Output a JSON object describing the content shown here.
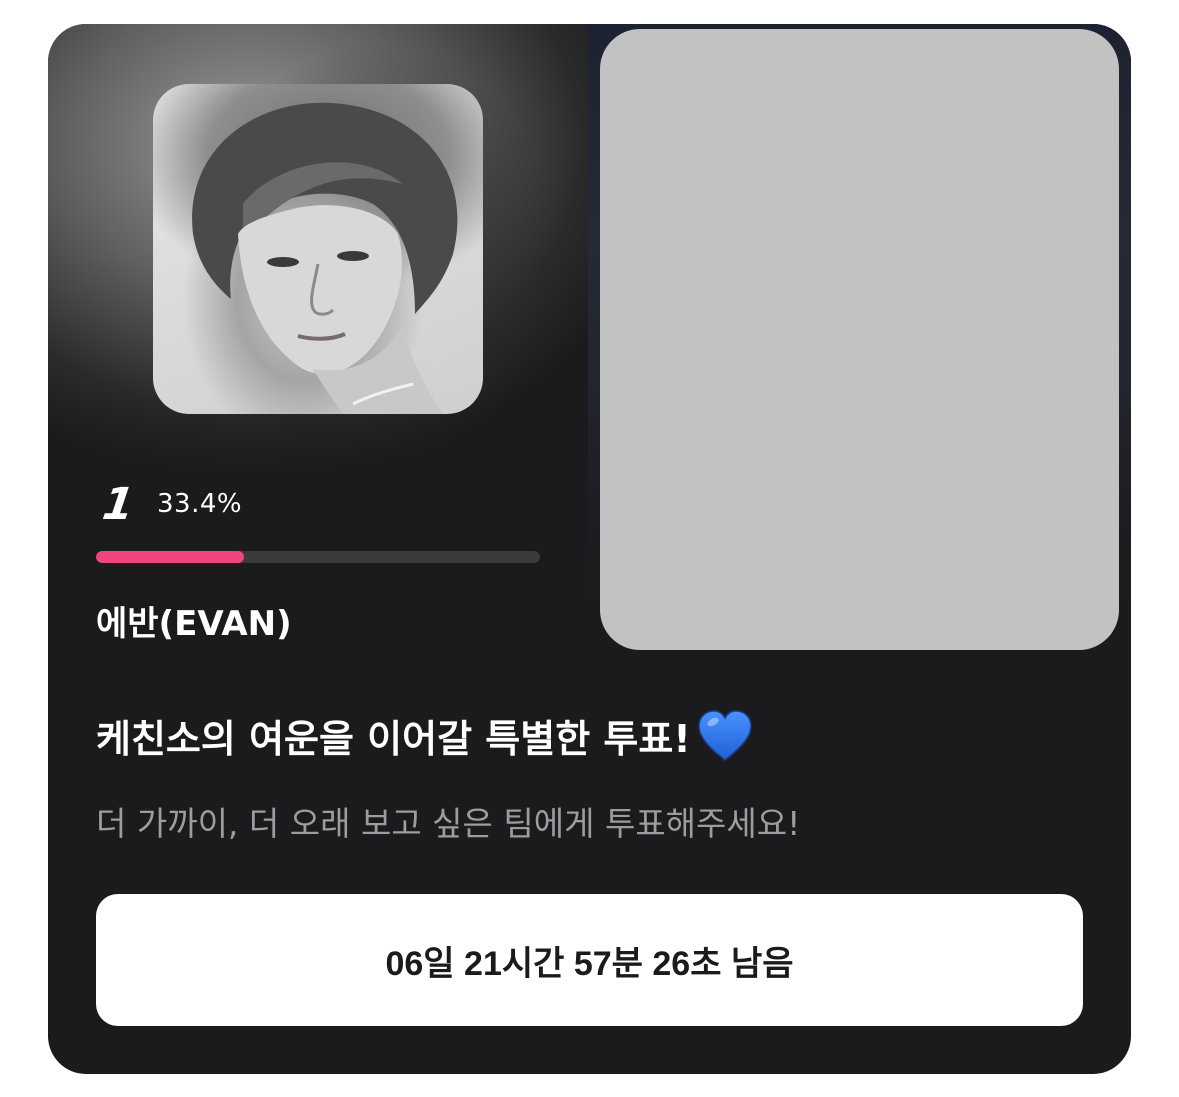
{
  "candidate": {
    "rank": "1",
    "percent_text": "33.4%",
    "vote_share": 0.334,
    "name": "에반(EVAN)",
    "bar_color": "#f0457e"
  },
  "vote": {
    "title": "케친소의 여운을 이어갈 특별한 투표!",
    "title_emoji": "blue-heart-icon",
    "subtitle": "더 가까이, 더 오래 보고 싶은 팀에게 투표해주세요!",
    "timer_label": "06일 21시간 57분 26초 남음"
  },
  "colors": {
    "card_background": "#1b1b1d",
    "placeholder": "#c2c2c2",
    "subtitle": "#9c9ca1",
    "heart": "#2f7df0"
  }
}
